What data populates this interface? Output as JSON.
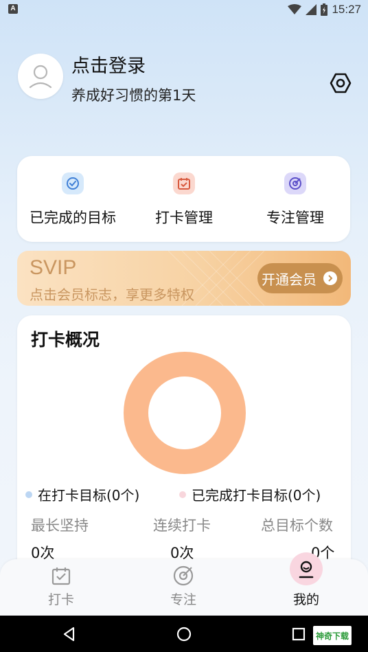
{
  "status_bar": {
    "time": "15:27",
    "notification_badge": "A"
  },
  "profile": {
    "login_text": "点击登录",
    "habit_text": "养成好习惯的第1天"
  },
  "quick_actions": [
    {
      "label": "已完成的目标",
      "icon": "check-circle-icon",
      "bg": "#d6e9fb",
      "color": "#3f7fd6"
    },
    {
      "label": "打卡管理",
      "icon": "calendar-check-icon",
      "bg": "#fbd8cf",
      "color": "#d85a3f"
    },
    {
      "label": "专注管理",
      "icon": "target-icon",
      "bg": "#dcd8f9",
      "color": "#5b4fc8"
    }
  ],
  "svip": {
    "title": "SVIP",
    "subtitle": "点击会员标志，享更多特权",
    "button_label": "开通会员"
  },
  "overview": {
    "title": "打卡概况",
    "legend": [
      {
        "label": "在打卡目标(0个)",
        "color": "#bcd6f3"
      },
      {
        "label": "已完成打卡目标(0个)",
        "color": "#f8d6dc"
      }
    ],
    "stats": [
      {
        "label": "最长坚持",
        "value": "0次"
      },
      {
        "label": "连续打卡",
        "value": "0次"
      },
      {
        "label": "总目标个数",
        "value": "0个"
      }
    ],
    "donut_color": "#fbb98d"
  },
  "tabs": [
    {
      "label": "打卡",
      "icon": "calendar-check-icon",
      "active": false
    },
    {
      "label": "专注",
      "icon": "target-icon",
      "active": false
    },
    {
      "label": "我的",
      "icon": "profile-face-icon",
      "active": true
    }
  ],
  "watermark": "神奇下载",
  "colors": {
    "accent_gold": "#c8904f",
    "svip_text": "#c99660"
  }
}
